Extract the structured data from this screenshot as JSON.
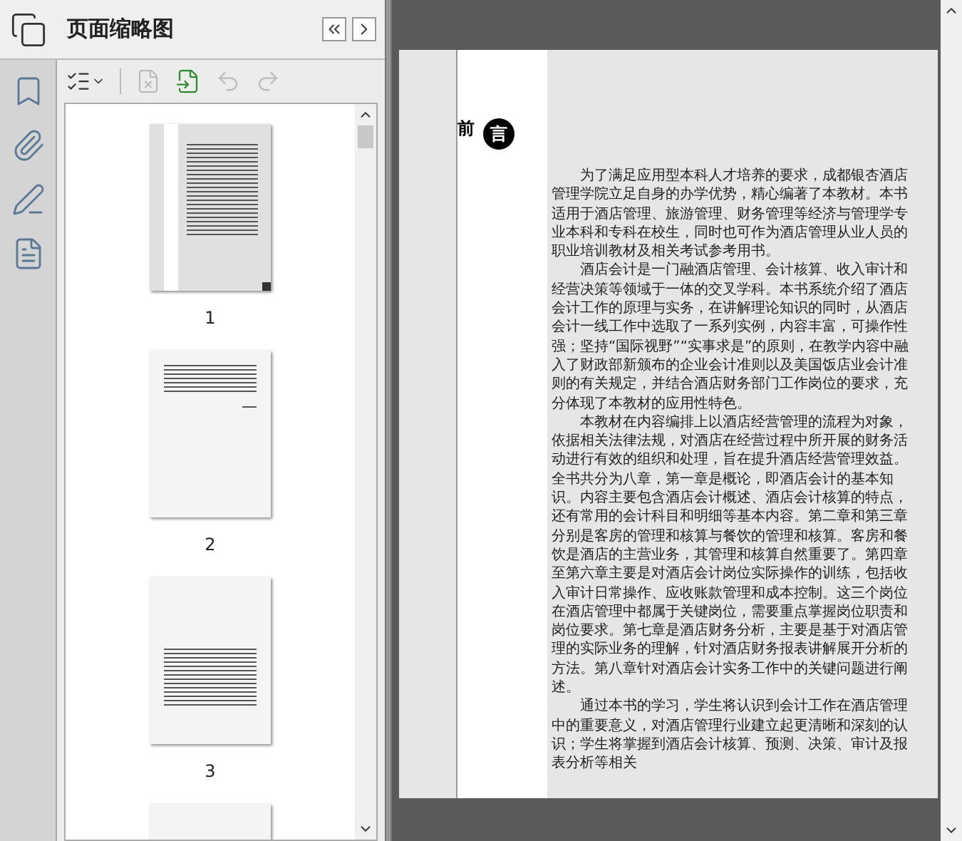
{
  "panel": {
    "title": "页面缩略图"
  },
  "side_icons": [
    {
      "kind": "bookmark",
      "selected": false
    },
    {
      "kind": "attachment",
      "selected": false
    },
    {
      "kind": "signature",
      "selected": false
    },
    {
      "kind": "document",
      "selected": false
    }
  ],
  "toolbar": [
    {
      "kind": "options",
      "disabled": false
    },
    {
      "kind": "delete",
      "disabled": true
    },
    {
      "kind": "insert",
      "disabled": false
    },
    {
      "kind": "undo",
      "disabled": true
    },
    {
      "kind": "redo",
      "disabled": true
    }
  ],
  "thumbnails": [
    {
      "kind": "cover",
      "label": "1",
      "selected": true
    },
    {
      "kind": "text",
      "label": "2",
      "selected": false
    },
    {
      "kind": "contents",
      "label": "3",
      "selected": false
    },
    {
      "kind": "contents",
      "selected": false
    }
  ],
  "document": {
    "heading": [
      "前",
      "言"
    ],
    "paragraphs": [
      "为了满足应用型本科人才培养的要求，成都银杏酒店管理学院立足自身的办学优势，精心编著了本教材。本书适用于酒店管理、旅游管理、财务管理等经济与管理学专业本科和专科在校生，同时也可作为酒店管理从业人员的职业培训教材及相关考试参考用书。",
      "酒店会计是一门融酒店管理、会计核算、收入审计和经营决策等领域于一体的交叉学科。本书系统介绍了酒店会计工作的原理与实务，在讲解理论知识的同时，从酒店会计一线工作中选取了一系列实例，内容丰富，可操作性强；坚持“国际视野”“实事求是”的原则，在教学内容中融入了财政部新颁布的企业会计准则以及美国饭店业会计准则的有关规定，并结合酒店财务部门工作岗位的要求，充分体现了本教材的应用性特色。",
      "本教材在内容编排上以酒店经营管理的流程为对象，依据相关法律法规，对酒店在经营过程中所开展的财务活动进行有效的组织和处理，旨在提升酒店经营管理效益。全书共分为八章，第一章是概论，即酒店会计的基本知识。内容主要包含酒店会计概述、酒店会计核算的特点，还有常用的会计科目和明细等基本内容。第二章和第三章分别是客房的管理和核算与餐饮的管理和核算。客房和餐饮是酒店的主营业务，其管理和核算自然重要了。第四章至第六章主要是对酒店会计岗位实际操作的训练，包括收入审计日常操作、应收账款管理和成本控制。这三个岗位在酒店管理中都属于关键岗位，需要重点掌握岗位职责和岗位要求。第七章是酒店财务分析，主要是基于对酒店管理的实际业务的理解，针对酒店财务报表讲解展开分析的方法。第八章针对酒店会计实务工作中的关键问题进行阐述。",
      "通过本书的学习，学生将认识到会计工作在酒店管理中的重要意义，对酒店管理行业建立起更清晰和深刻的认识；学生将掌握到酒店会计核算、预测、决策、审计及报表分析等相关"
    ]
  }
}
